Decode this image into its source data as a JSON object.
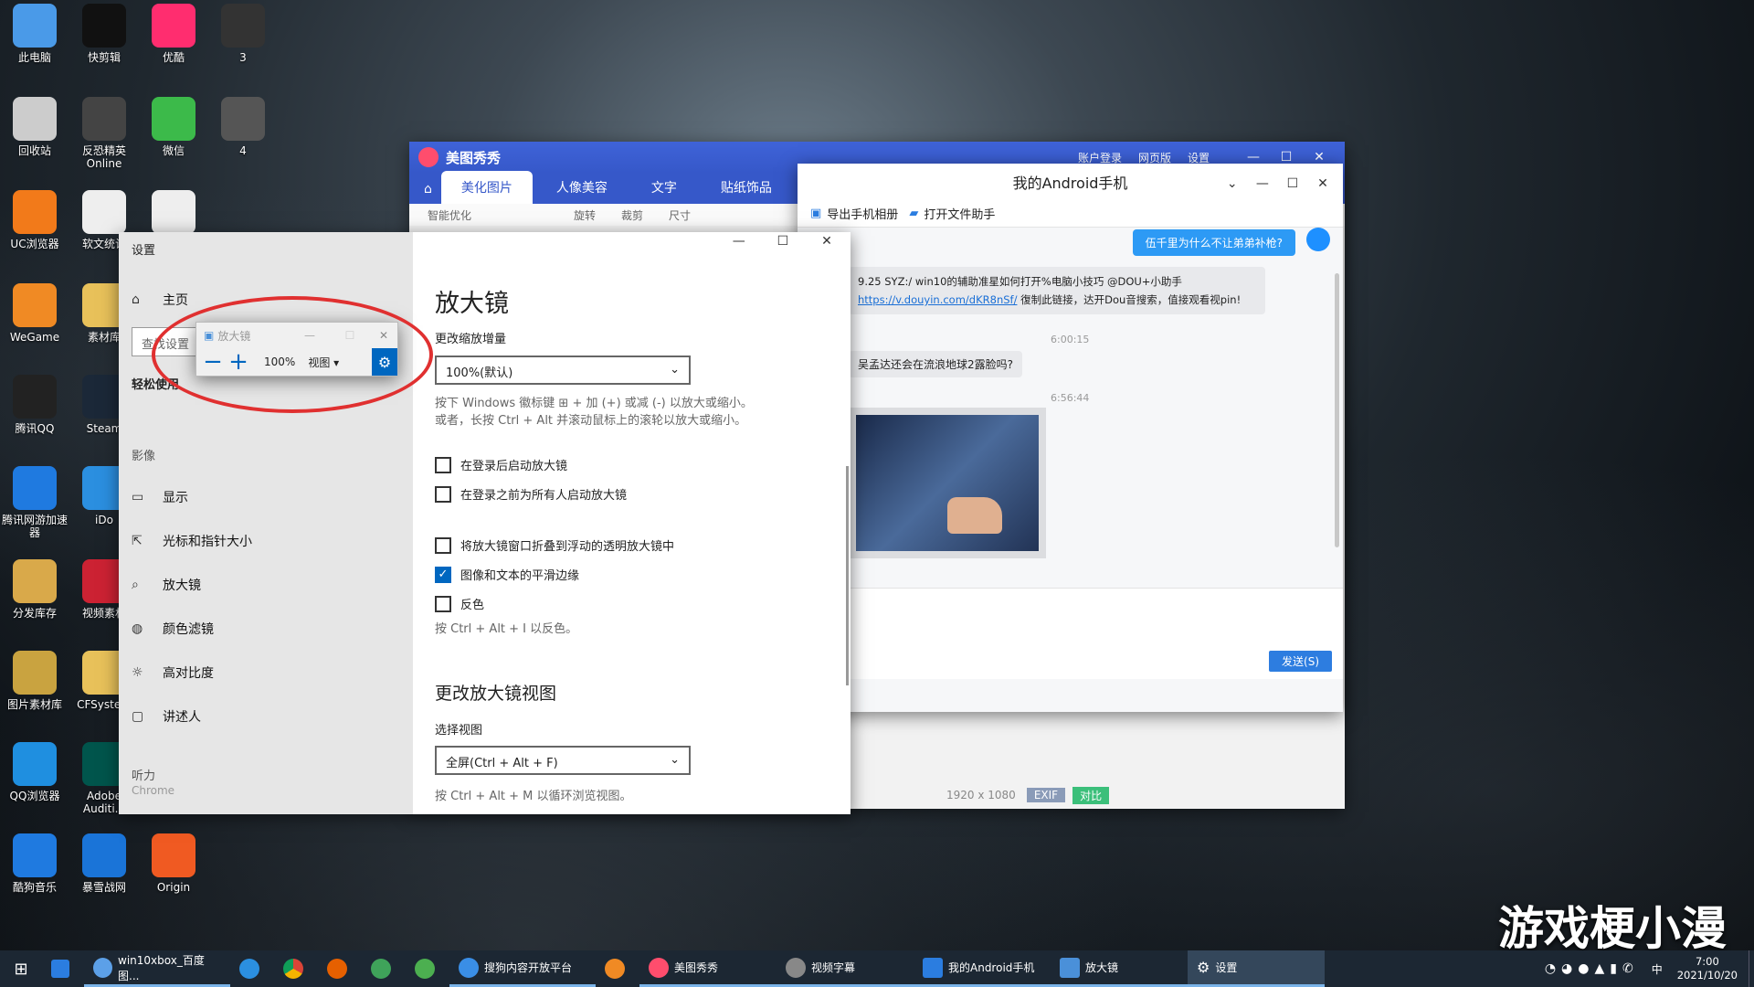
{
  "desktop": {
    "icons": [
      "此电脑",
      "快剪辑",
      "优酷",
      "3",
      "回收站",
      "反恐精英Online",
      "微信",
      "4",
      "UC浏览器",
      "软文统计",
      "",
      "WeGame",
      "素材库",
      "腾讯QQ",
      "Steam",
      "腾讯网游加速器",
      "iDo",
      "分发库存",
      "视频素材",
      "图片素材库",
      "CFSystem",
      "QQ浏览器",
      "Adobe Auditi...",
      "酷狗音乐",
      "暴雪战网",
      "Origin"
    ]
  },
  "meitu": {
    "title": "美图秀秀",
    "account": "账户登录",
    "web": "网页版",
    "settings": "设置",
    "tabs": [
      "美化图片",
      "人像美容",
      "文字",
      "贴纸饰品"
    ],
    "toolbar": {
      "smart": "智能优化",
      "rotate": "旋转",
      "crop": "裁剪",
      "size": "尺寸"
    },
    "footer": {
      "resolution": "1920 x 1080",
      "exif": "EXIF",
      "compare": "对比"
    }
  },
  "android": {
    "title": "我的Android手机",
    "export": "导出手机相册",
    "openfile": "打开文件助手",
    "msg1": "伍千里为什么不让弟弟补枪?",
    "msg2": "9.25 SYZ:/ win10的辅助准星如何打开%电脑小技巧 @DOU+小助手",
    "msg2link": "https://v.douyin.com/dKR8nSf/",
    "msg2tail": "復制此链接，达开Dou音搜索，值接观看视pin!",
    "time1": "6:00:15",
    "msg3": "吴孟达还会在流浪地球2露脸吗?",
    "time2": "6:56:44",
    "send": "发送(S)"
  },
  "settings": {
    "title": "设置",
    "home": "主页",
    "search": "查找设置",
    "section_ease": "轻松使用",
    "vision": "影像",
    "items": [
      "显示",
      "光标和指针大小",
      "放大镜",
      "颜色滤镜",
      "高对比度",
      "讲述人"
    ],
    "hearing": "听力",
    "hearing_item": "Chrome"
  },
  "magnifier": {
    "heading": "放大镜",
    "zoom_label": "更改缩放增量",
    "zoom_value": "100%(默认)",
    "hint1": "按下 Windows 徽标键 ⊞ + 加 (+) 或减 (-) 以放大或缩小。",
    "hint2": "或者，长按 Ctrl + Alt 并滚动鼠标上的滚轮以放大或缩小。",
    "cb1": "在登录后启动放大镜",
    "cb2": "在登录之前为所有人启动放大镜",
    "cb3": "将放大镜窗口折叠到浮动的透明放大镜中",
    "cb4": "图像和文本的平滑边缘",
    "cb5": "反色",
    "hint3": "按 Ctrl + Alt + I 以反色。",
    "view_heading": "更改放大镜视图",
    "view_label": "选择视图",
    "view_value": "全屏(Ctrl + Alt + F)",
    "hint4": "按 Ctrl + Alt + M 以循环浏览视图。"
  },
  "mini": {
    "title": "放大镜",
    "zoom": "100%",
    "view": "视图"
  },
  "taskbar": {
    "items": [
      "win10xbox_百度图...",
      "搜狗内容开放平台",
      "美图秀秀",
      "视频字幕",
      "我的Android手机",
      "放大镜",
      "设置"
    ],
    "time": "7:00",
    "date": "2021/10/20",
    "ime": "中"
  },
  "watermark": "游戏梗小漫",
  "colors": {
    "accent": "#3658c9",
    "blue": "#0067c0",
    "circle": "#e03030"
  }
}
